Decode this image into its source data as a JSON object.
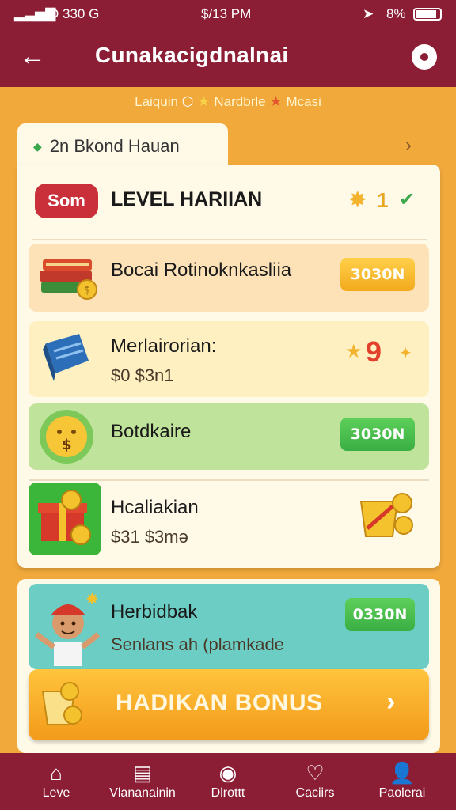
{
  "status": {
    "carrier": "Ð 330 G",
    "time": "$/13 PM",
    "battery": "8%"
  },
  "header": {
    "title": "Cunakacigdnalnai",
    "back_icon": "arrow-left-icon",
    "menu_icon": "record-icon"
  },
  "ribbon": {
    "text1": "Laiquin",
    "text2": "Nardbrle",
    "text3": "Mcasi"
  },
  "tab": {
    "label": "2n Bkond Hauan"
  },
  "level": {
    "badge": "Som",
    "title": "LEVEL HARIIAN",
    "value": "1"
  },
  "tasks": [
    {
      "title": "Bocai Rotinoknkasliia",
      "button": "3030N"
    },
    {
      "title": "Merlairorian:",
      "subtitle": "$0 $3n1",
      "reward": "9"
    },
    {
      "title": "Botdkaire",
      "button": "3030N"
    },
    {
      "title": "Hcaliakian",
      "subtitle": "$31 $3mə"
    }
  ],
  "featured": {
    "title": "Herbidbak",
    "subtitle": "Senlans ah (plamkade",
    "button": "0330N"
  },
  "bonus": {
    "label": "HADIKAN BONUS"
  },
  "nav": [
    {
      "label": "Leve",
      "icon": "home-icon"
    },
    {
      "label": "Vlananainin",
      "icon": "list-icon"
    },
    {
      "label": "Dlrottt",
      "icon": "circle-icon"
    },
    {
      "label": "Caciirs",
      "icon": "heart-icon"
    },
    {
      "label": "Paolerai",
      "icon": "user-icon"
    }
  ],
  "colors": {
    "primary": "#8b1d35",
    "background": "#f2a93b",
    "accent_yellow": "#f3a91c",
    "accent_green": "#3aae43"
  }
}
